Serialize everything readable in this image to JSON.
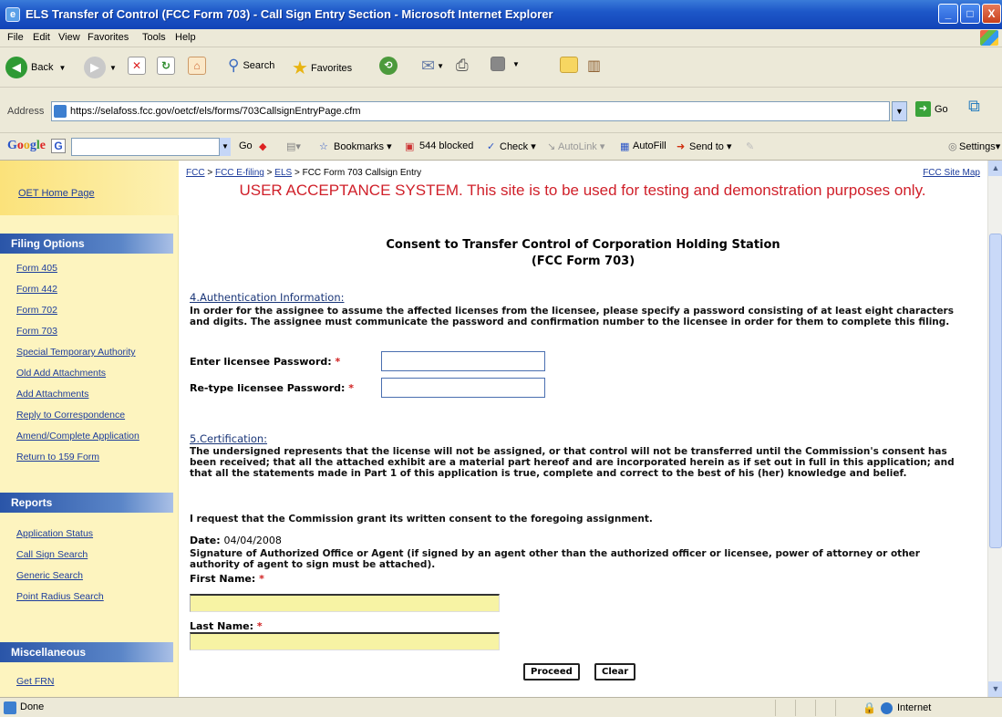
{
  "window": {
    "title": "ELS Transfer of Control (FCC Form 703) - Call Sign Entry Section - Microsoft Internet Explorer",
    "minimize": "_",
    "maximize": "□",
    "close": "X"
  },
  "menu": [
    "File",
    "Edit",
    "View",
    "Favorites",
    "Tools",
    "Help"
  ],
  "toolbar": {
    "back": "Back",
    "search": "Search",
    "favorites": "Favorites"
  },
  "address": {
    "label": "Address",
    "url": "https://selafoss.fcc.gov/oetcf/els/forms/703CallsignEntryPage.cfm",
    "go": "Go"
  },
  "googlebar": {
    "logo": "Google",
    "go": "Go",
    "bookmarks": "Bookmarks",
    "blocked": "544 blocked",
    "check": "Check",
    "autolink": "AutoLink",
    "autofill": "AutoFill",
    "sendto": "Send to",
    "settings": "Settings"
  },
  "sidebar": {
    "home": "OET Home Page",
    "filing_title": "Filing Options",
    "filing": [
      "Form 405",
      "Form 442",
      "Form 702",
      "Form 703",
      "Special Temporary Authority",
      "Old Add Attachments",
      "Add Attachments",
      "Reply to Correspondence",
      "Amend/Complete Application",
      "Return to 159 Form"
    ],
    "reports_title": "Reports",
    "reports": [
      "Application Status",
      "Call Sign Search",
      "Generic Search",
      "Point Radius Search"
    ],
    "misc_title": "Miscellaneous",
    "misc": [
      "Get FRN"
    ]
  },
  "breadcrumb": {
    "fcc": "FCC",
    "sep": " > ",
    "efiling": "FCC E-filing",
    "els": "ELS",
    "current": "FCC Form 703 Callsign Entry"
  },
  "site_map": "FCC Site Map",
  "warning": "USER ACCEPTANCE SYSTEM. This site is to be used for testing and demonstration purposes only.",
  "form": {
    "title_line1": "Consent to Transfer Control of Corporation Holding Station",
    "title_line2": "(FCC Form 703)",
    "auth_heading": "4.Authentication Information:",
    "auth_text": "In order for the assignee to assume the affected licenses from the licensee, please specify a password consisting of at least eight characters and digits. The assignee must communicate the password and confirmation number to the licensee in order for them to complete this filing.",
    "pw_label": "Enter licensee Password:",
    "pw2_label": "Re-type licensee Password:",
    "required": "*",
    "cert_heading": "5.Certification:",
    "cert_text": "The undersigned represents that the license will not be assigned, or that control will not be transferred until the Commission's consent has been received; that all the attached exhibit are a material part hereof and are incorporated herein as if set out in full in this application; and that all the statements made in Part 1 of this application is true, complete and correct to the best of his (her) knowledge and belief.",
    "request_text": "I request that the Commission grant its written consent to the foregoing assignment.",
    "date_label": "Date:",
    "date_value": "04/04/2008",
    "signature_text": "Signature of Authorized Office or Agent (if signed by an agent other than the authorized officer or licensee, power of attorney or other authority of agent to sign must be attached).",
    "first_name_label": "First Name:",
    "last_name_label": "Last Name:",
    "proceed": "Proceed",
    "clear": "Clear"
  },
  "status": {
    "text": "Done",
    "zone": "Internet"
  }
}
